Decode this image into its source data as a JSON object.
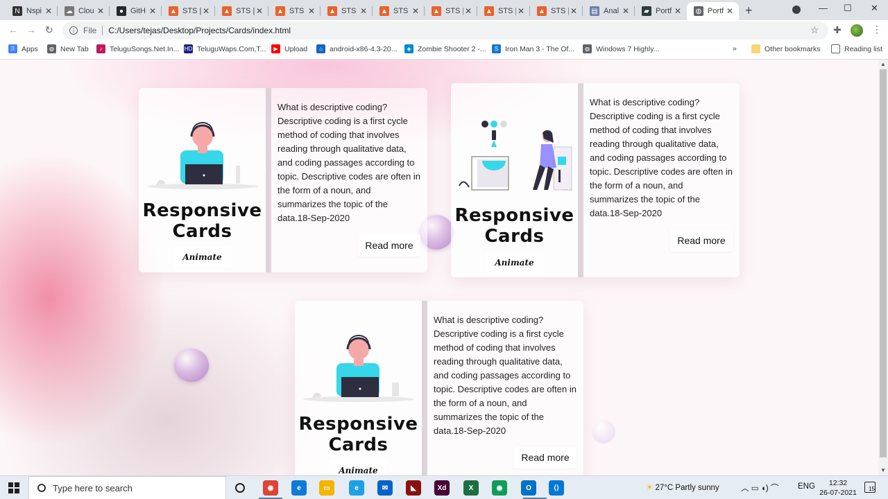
{
  "browser": {
    "tabs": [
      {
        "title": "Nspi",
        "fav_color": "#333333",
        "fav_glyph": "N"
      },
      {
        "title": "Clou",
        "fav_color": "#777777",
        "fav_glyph": "☁"
      },
      {
        "title": "GitH",
        "fav_color": "#24292e",
        "fav_glyph": "●"
      },
      {
        "title": "STS |",
        "fav_color": "#e8632b",
        "fav_glyph": "▲"
      },
      {
        "title": "STS |",
        "fav_color": "#e8632b",
        "fav_glyph": "▲"
      },
      {
        "title": "STS |",
        "fav_color": "#e8632b",
        "fav_glyph": "▲"
      },
      {
        "title": "STS |",
        "fav_color": "#e8632b",
        "fav_glyph": "▲"
      },
      {
        "title": "STS |",
        "fav_color": "#e8632b",
        "fav_glyph": "▲"
      },
      {
        "title": "STS |",
        "fav_color": "#e8632b",
        "fav_glyph": "▲"
      },
      {
        "title": "STS |",
        "fav_color": "#e8632b",
        "fav_glyph": "▲"
      },
      {
        "title": "STS |",
        "fav_color": "#e8632b",
        "fav_glyph": "▲"
      },
      {
        "title": "Anal",
        "fav_color": "#6b7fa8",
        "fav_glyph": "▤"
      },
      {
        "title": "Portf",
        "fav_color": "#2d3b3b",
        "fav_glyph": "▰"
      },
      {
        "title": "Portf",
        "fav_color": "#5f6368",
        "fav_glyph": "◍"
      }
    ],
    "active_tab_index": 13,
    "new_tab_glyph": "+",
    "close_glyph": "✕",
    "window_controls": {
      "minimize": "—",
      "maximize": "☐",
      "close": "✕"
    },
    "nav": {
      "back": "←",
      "forward": "→",
      "reload": "↻"
    },
    "omnibox": {
      "scheme_label": "File",
      "url": "C:/Users/tejas/Desktop/Projects/Cards/index.html",
      "info_glyph": "i"
    },
    "icons": {
      "star": "☆",
      "extensions": "✚",
      "menu": "⋮"
    },
    "bookmarks": [
      {
        "label": "Apps",
        "icon": "apps-grid-icon",
        "color": "#4285f4",
        "glyph": "⠿"
      },
      {
        "label": "New Tab",
        "icon": "globe-icon",
        "color": "#5f6368",
        "glyph": "◍"
      },
      {
        "label": "TeluguSongs.Net.In...",
        "icon": "music-icon",
        "color": "#c2185b",
        "glyph": "♪"
      },
      {
        "label": "TeluguWaps.Com,T...",
        "icon": "hd-icon",
        "color": "#1a237e",
        "glyph": "HD"
      },
      {
        "label": "Upload",
        "icon": "youtube-icon",
        "color": "#ff0000",
        "glyph": "▶"
      },
      {
        "label": "android-x86-4.3-20...",
        "icon": "sourceforge-icon",
        "color": "#1565c0",
        "glyph": "⌂"
      },
      {
        "label": "Zombie Shooter 2 -...",
        "icon": "game-icon",
        "color": "#0288d1",
        "glyph": "◈"
      },
      {
        "label": "Iron Man 3 - The Of...",
        "icon": "s-icon",
        "color": "#1976d2",
        "glyph": "S"
      },
      {
        "label": "Windows 7 Highly...",
        "icon": "globe-icon",
        "color": "#5f6368",
        "glyph": "◍"
      }
    ],
    "bookmarks_overflow": "»",
    "other_bookmarks": "Other bookmarks",
    "reading_list": "Reading list"
  },
  "cards": [
    {
      "title_line1": "Responsive",
      "title_line2": "Cards",
      "animate_label": "Animate",
      "description": "What is descriptive coding? Descriptive coding is a first cycle method of coding that involves reading through qualitative data, and coding passages according to topic. Descriptive codes are often in the form of a noun, and summarizes the topic of the data.18-Sep-2020",
      "read_more_label": "Read more",
      "illustration": "person-laptop"
    },
    {
      "title_line1": "Responsive",
      "title_line2": "Cards",
      "animate_label": "Animate",
      "description": "What is descriptive coding? Descriptive coding is a first cycle method of coding that involves reading through qualitative data, and coding passages according to topic. Descriptive codes are often in the form of a noun, and summarizes the topic of the data.18-Sep-2020",
      "read_more_label": "Read more",
      "illustration": "woman-lab"
    },
    {
      "title_line1": "Responsive",
      "title_line2": "Cards",
      "animate_label": "Animate",
      "description": "What is descriptive coding? Descriptive coding is a first cycle method of coding that involves reading through qualitative data, and coding passages according to topic. Descriptive codes are often in the form of a noun, and summarizes the topic of the data.18-Sep-2020",
      "read_more_label": "Read more",
      "illustration": "person-laptop"
    }
  ],
  "taskbar": {
    "search_placeholder": "Type here to search",
    "apps": [
      {
        "name": "chrome-icon",
        "color": "#db4437",
        "glyph": "◉"
      },
      {
        "name": "edge-icon",
        "color": "#0f7bd6",
        "glyph": "e"
      },
      {
        "name": "file-explorer-icon",
        "color": "#f4b400",
        "glyph": "▭"
      },
      {
        "name": "internet-explorer-icon",
        "color": "#1ea0e6",
        "glyph": "e"
      },
      {
        "name": "mail-icon",
        "color": "#0a64c8",
        "glyph": "✉"
      },
      {
        "name": "app-red-icon",
        "color": "#8b1010",
        "glyph": "◣"
      },
      {
        "name": "adobe-xd-icon",
        "color": "#470137",
        "glyph": "Xd"
      },
      {
        "name": "excel-icon",
        "color": "#1d6f42",
        "glyph": "X"
      },
      {
        "name": "chrome-alt-icon",
        "color": "#0f9d58",
        "glyph": "◉"
      },
      {
        "name": "outlook-icon",
        "color": "#0072c6",
        "glyph": "O"
      },
      {
        "name": "vscode-icon",
        "color": "#0078d4",
        "glyph": "⟨⟩"
      }
    ],
    "weather": "27°C  Partly sunny",
    "language": "ENG",
    "time": "12:32",
    "date": "26-07-2021",
    "notification_count": "15",
    "tray_glyphs": "︿  ▭  ◖)  ⌒"
  },
  "colors": {
    "page_bg": "#fdf6f8",
    "accent_pink": "#ec6c8c",
    "head_cyan": "#36d7e8",
    "laptop": "#2f2e41"
  }
}
